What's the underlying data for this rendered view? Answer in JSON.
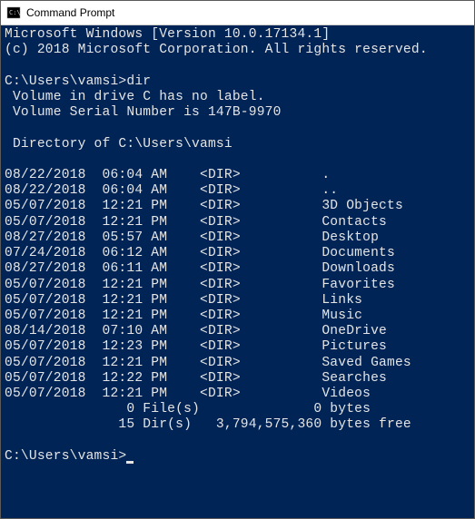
{
  "window": {
    "title": "Command Prompt"
  },
  "terminal": {
    "header_line1": "Microsoft Windows [Version 10.0.17134.1]",
    "header_line2": "(c) 2018 Microsoft Corporation. All rights reserved.",
    "prompt1": "C:\\Users\\vamsi>",
    "command1": "dir",
    "volume_label": " Volume in drive C has no label.",
    "volume_serial": " Volume Serial Number is 147B-9970",
    "directory_of": " Directory of C:\\Users\\vamsi",
    "entries": [
      {
        "date": "08/22/2018",
        "time": "06:04 AM",
        "type": "<DIR>",
        "name": "."
      },
      {
        "date": "08/22/2018",
        "time": "06:04 AM",
        "type": "<DIR>",
        "name": ".."
      },
      {
        "date": "05/07/2018",
        "time": "12:21 PM",
        "type": "<DIR>",
        "name": "3D Objects"
      },
      {
        "date": "05/07/2018",
        "time": "12:21 PM",
        "type": "<DIR>",
        "name": "Contacts"
      },
      {
        "date": "08/27/2018",
        "time": "05:57 AM",
        "type": "<DIR>",
        "name": "Desktop"
      },
      {
        "date": "07/24/2018",
        "time": "06:12 AM",
        "type": "<DIR>",
        "name": "Documents"
      },
      {
        "date": "08/27/2018",
        "time": "06:11 AM",
        "type": "<DIR>",
        "name": "Downloads"
      },
      {
        "date": "05/07/2018",
        "time": "12:21 PM",
        "type": "<DIR>",
        "name": "Favorites"
      },
      {
        "date": "05/07/2018",
        "time": "12:21 PM",
        "type": "<DIR>",
        "name": "Links"
      },
      {
        "date": "05/07/2018",
        "time": "12:21 PM",
        "type": "<DIR>",
        "name": "Music"
      },
      {
        "date": "08/14/2018",
        "time": "07:10 AM",
        "type": "<DIR>",
        "name": "OneDrive"
      },
      {
        "date": "05/07/2018",
        "time": "12:23 PM",
        "type": "<DIR>",
        "name": "Pictures"
      },
      {
        "date": "05/07/2018",
        "time": "12:21 PM",
        "type": "<DIR>",
        "name": "Saved Games"
      },
      {
        "date": "05/07/2018",
        "time": "12:22 PM",
        "type": "<DIR>",
        "name": "Searches"
      },
      {
        "date": "05/07/2018",
        "time": "12:21 PM",
        "type": "<DIR>",
        "name": "Videos"
      }
    ],
    "summary_files": "               0 File(s)              0 bytes",
    "summary_dirs": "              15 Dir(s)   3,794,575,360 bytes free",
    "prompt2": "C:\\Users\\vamsi>"
  }
}
